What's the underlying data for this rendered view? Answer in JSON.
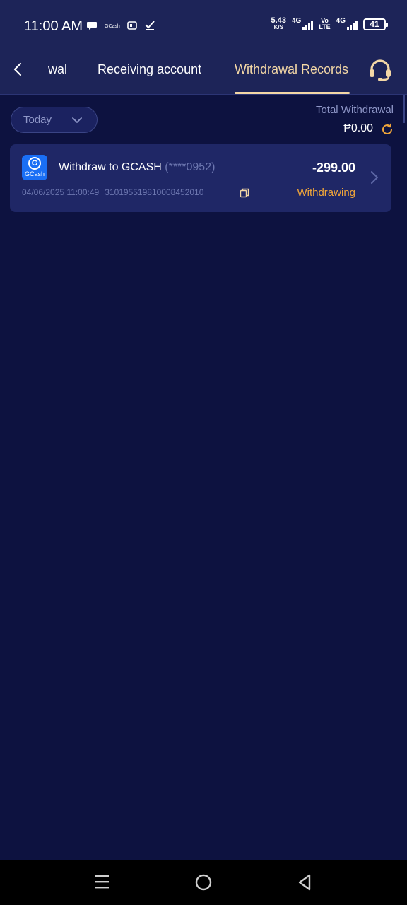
{
  "status_bar": {
    "time": "11:00 AM",
    "left_icons": [
      "message-icon",
      "gcash-notif-icon",
      "payment-app-icon",
      "checkmark-icon"
    ],
    "gcash_notif_text": "GCash",
    "net_speed_value": "5.43",
    "net_speed_unit": "K/S",
    "sim1_label": "4G",
    "volte_top": "Vo",
    "volte_bottom": "LTE",
    "sim2_label": "4G",
    "battery": "41"
  },
  "header": {
    "tabs": [
      {
        "label": "wal"
      },
      {
        "label": "Receiving account"
      },
      {
        "label": "Withdrawal Records"
      }
    ],
    "active_tab": "Withdrawal Records",
    "active_color": "#f3d7a6"
  },
  "filter": {
    "date_label": "Today"
  },
  "summary": {
    "title": "Total Withdrawal",
    "amount": "₱0.00"
  },
  "records": [
    {
      "method_logo_text": "GCash",
      "title": "Withdraw to GCASH",
      "account_masked": "(****0952)",
      "amount": "-299.00",
      "datetime": "04/06/2025 11:00:49",
      "order_id": "310195519810008452010",
      "status": "Withdrawing",
      "status_color": "#f0a53a"
    }
  ],
  "colors": {
    "background": "#0d1240",
    "header": "#1d2458",
    "card": "#1f2766",
    "accent": "#f3d7a6",
    "muted_text": "#8f97c8"
  }
}
